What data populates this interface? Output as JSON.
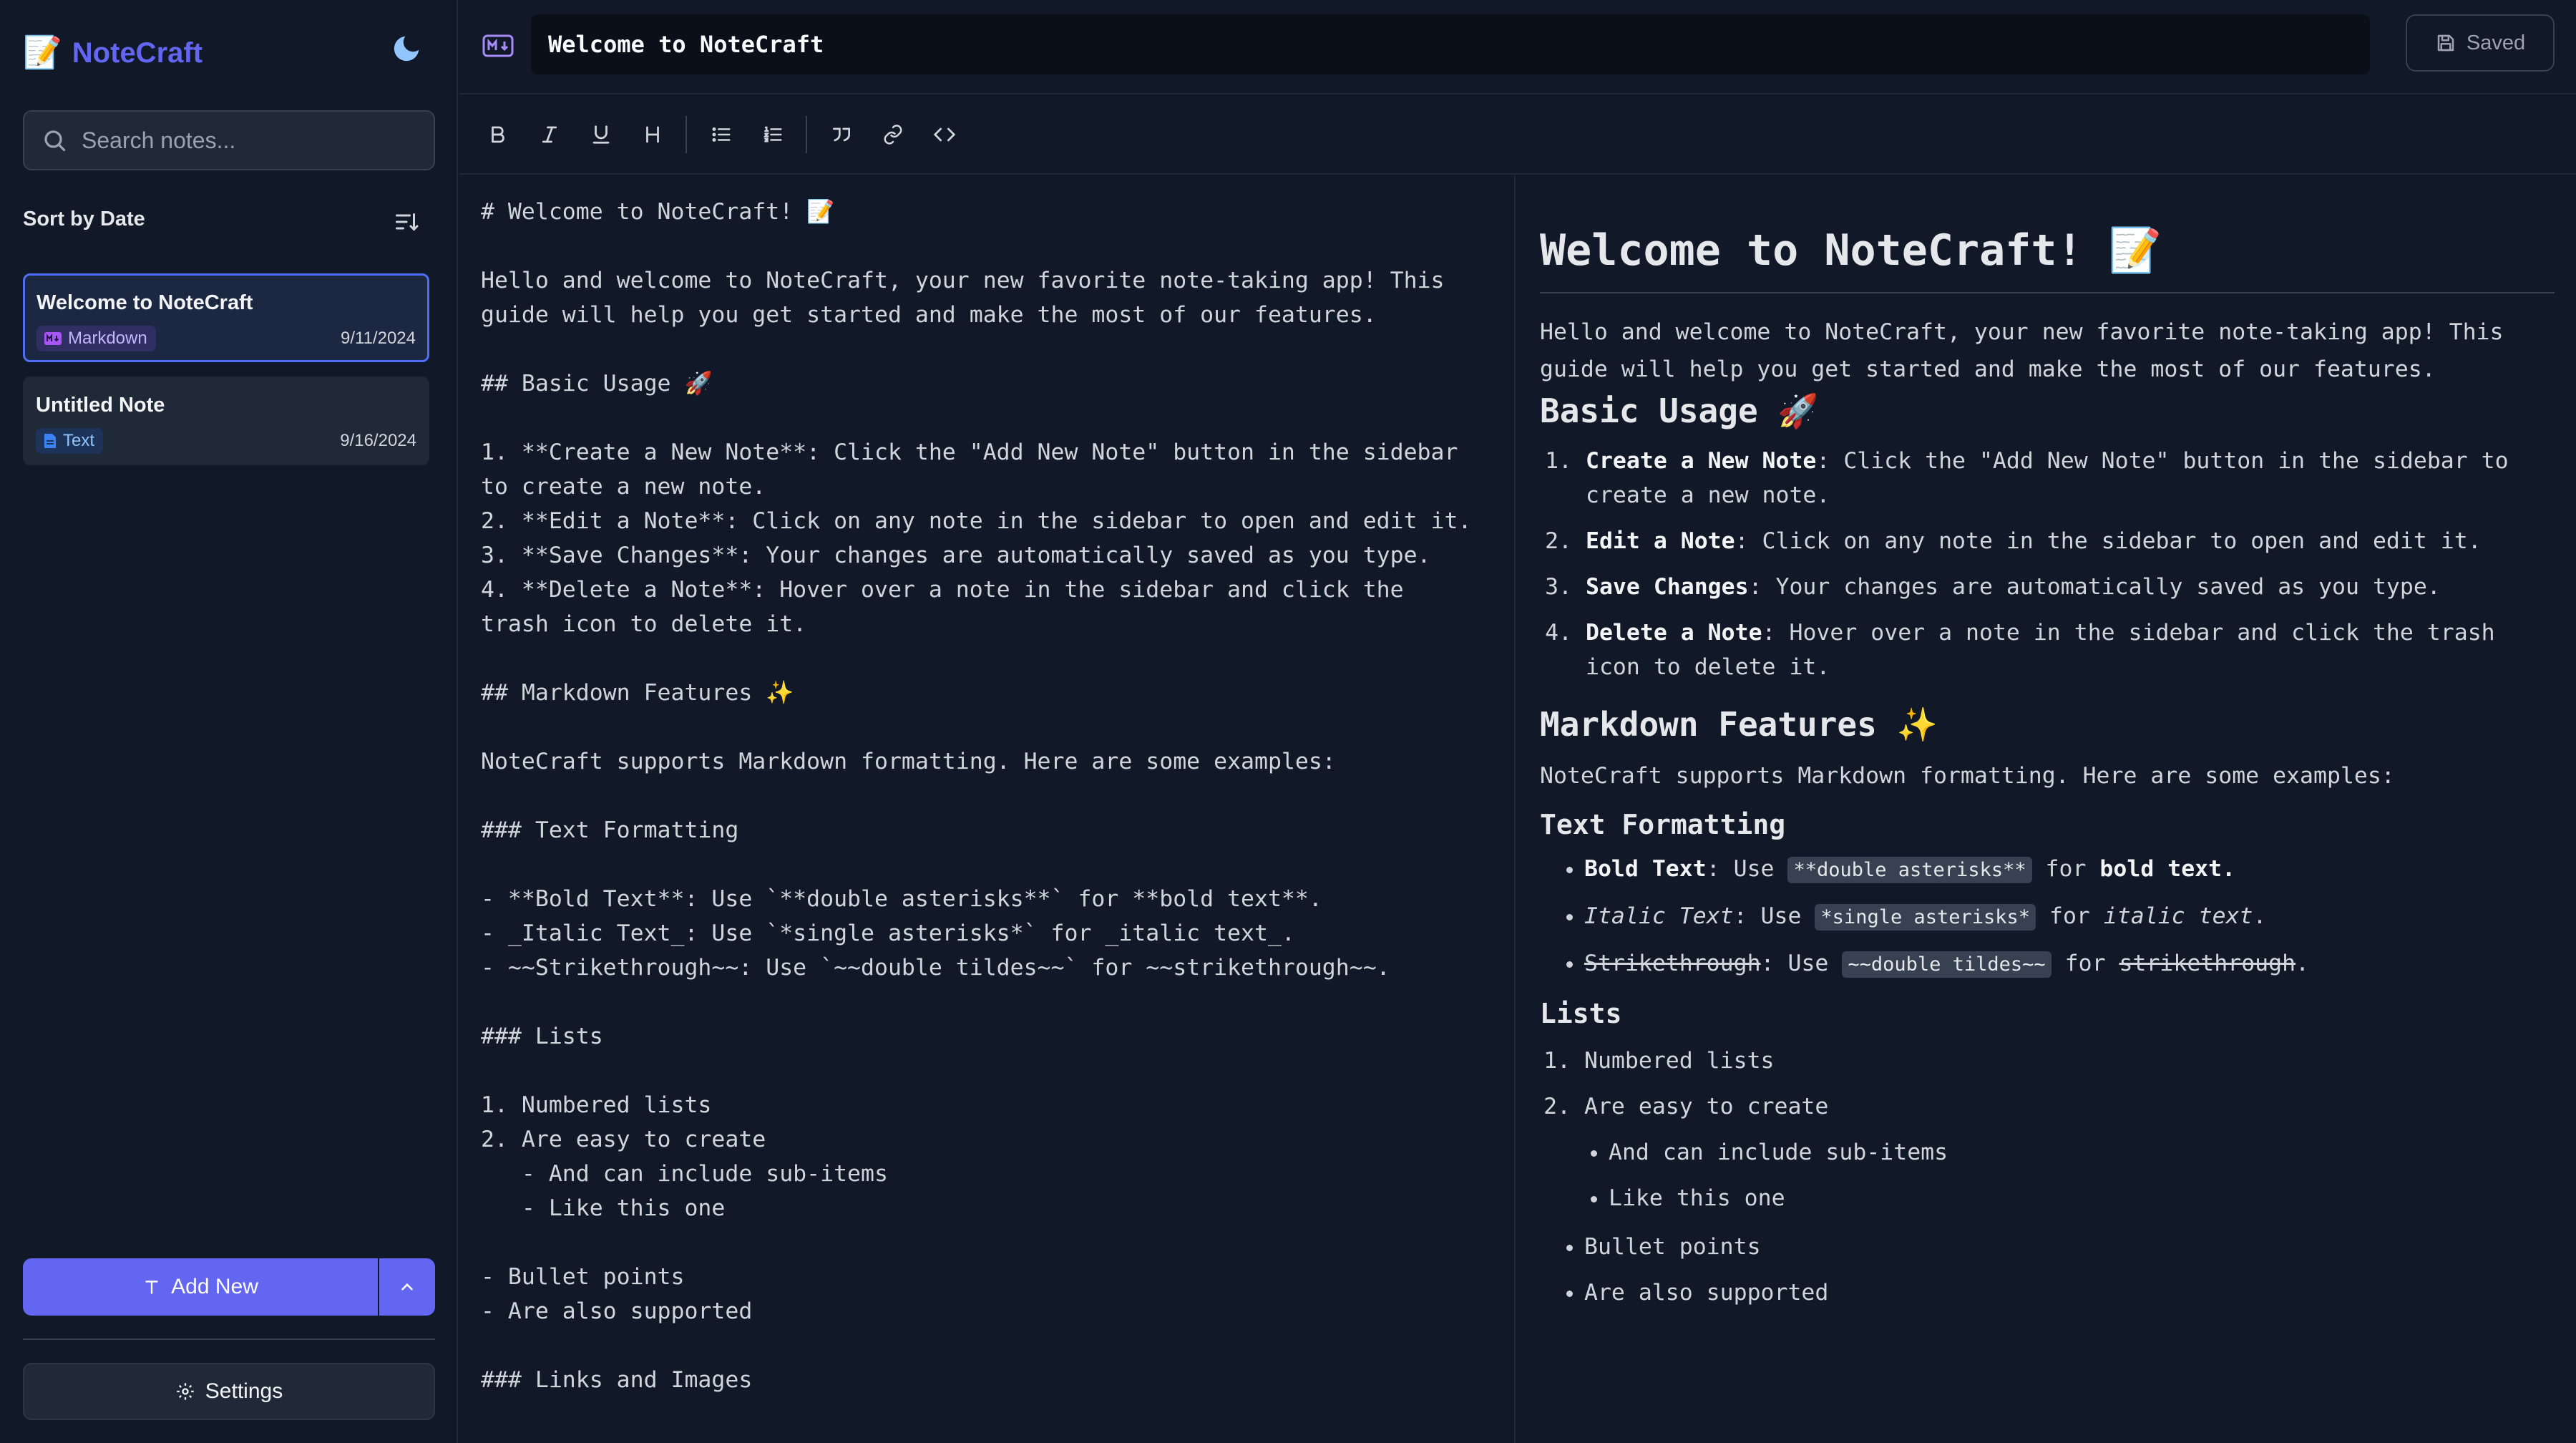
{
  "app": {
    "brand_emoji": "📝",
    "brand_name": "NoteCraft",
    "accent_color": "#6366f1"
  },
  "sidebar": {
    "search_placeholder": "Search notes...",
    "sort_label": "Sort by Date",
    "notes": [
      {
        "title": "Welcome to NoteCraft",
        "type": "Markdown",
        "date": "9/11/2024",
        "active": true
      },
      {
        "title": "Untitled Note",
        "type": "Text",
        "date": "9/16/2024",
        "active": false
      }
    ],
    "add_new_label": "Add New",
    "settings_label": "Settings"
  },
  "header": {
    "title_value": "Welcome to NoteCraft",
    "saved_label": "Saved"
  },
  "toolbar": {
    "buttons": [
      "bold-icon",
      "italic-icon",
      "underline-icon",
      "heading-icon",
      "bullet-list-icon",
      "numbered-list-icon",
      "quote-icon",
      "link-icon",
      "code-icon"
    ]
  },
  "editor": {
    "lines": [
      "# Welcome to NoteCraft! 📝",
      "",
      "Hello and welcome to NoteCraft, your new favorite note-taking app! This",
      "guide will help you get started and make the most of our features.",
      "",
      "## Basic Usage 🚀",
      "",
      "1. **Create a New Note**: Click the \"Add New Note\" button in the sidebar",
      "to create a new note.",
      "2. **Edit a Note**: Click on any note in the sidebar to open and edit it.",
      "3. **Save Changes**: Your changes are automatically saved as you type.",
      "4. **Delete a Note**: Hover over a note in the sidebar and click the",
      "trash icon to delete it.",
      "",
      "## Markdown Features ✨",
      "",
      "NoteCraft supports Markdown formatting. Here are some examples:",
      "",
      "### Text Formatting",
      "",
      "- **Bold Text**: Use `**double asterisks**` for **bold text**.",
      "- _Italic Text_: Use `*single asterisks*` for _italic text_.",
      "- ~~Strikethrough~~: Use `~~double tildes~~` for ~~strikethrough~~.",
      "",
      "### Lists",
      "",
      "1. Numbered lists",
      "2. Are easy to create",
      "   - And can include sub-items",
      "   - Like this one",
      "",
      "- Bullet points",
      "- Are also supported",
      "",
      "### Links and Images",
      ""
    ]
  },
  "preview": {
    "h1": "Welcome to NoteCraft! 📝",
    "intro": "Hello and welcome to NoteCraft, your new favorite note-taking app! This guide will help you get started and make the most of our features.",
    "basic_usage": {
      "heading": "Basic Usage 🚀",
      "items": [
        {
          "bold": "Create a New Note",
          "rest": ": Click the \"Add New Note\" button in the sidebar to create a new note."
        },
        {
          "bold": "Edit a Note",
          "rest": ": Click on any note in the sidebar to open and edit it."
        },
        {
          "bold": "Save Changes",
          "rest": ": Your changes are automatically saved as you type."
        },
        {
          "bold": "Delete a Note",
          "rest": ": Hover over a note in the sidebar and click the trash icon to delete it."
        }
      ]
    },
    "markdown_features": {
      "heading": "Markdown Features ✨",
      "intro": "NoteCraft supports Markdown formatting. Here are some examples:"
    },
    "text_formatting": {
      "heading": "Text Formatting",
      "bold": {
        "label": "Bold Text",
        "use": ": Use ",
        "code": "**double asterisks**",
        "for": " for ",
        "example": "bold text",
        "end": "."
      },
      "italic": {
        "label": "Italic Text",
        "use": ": Use ",
        "code": "*single asterisks*",
        "for": " for ",
        "example": "italic text",
        "end": "."
      },
      "strike": {
        "label": "Strikethrough",
        "use": ": Use ",
        "code": "~~double tildes~~",
        "for": " for ",
        "example": "strikethrough",
        "end": "."
      }
    },
    "lists": {
      "heading": "Lists",
      "numbered": [
        "Numbered lists",
        "Are easy to create"
      ],
      "sub_items": [
        "And can include sub-items",
        "Like this one"
      ],
      "bullets": [
        "Bullet points",
        "Are also supported"
      ]
    }
  }
}
